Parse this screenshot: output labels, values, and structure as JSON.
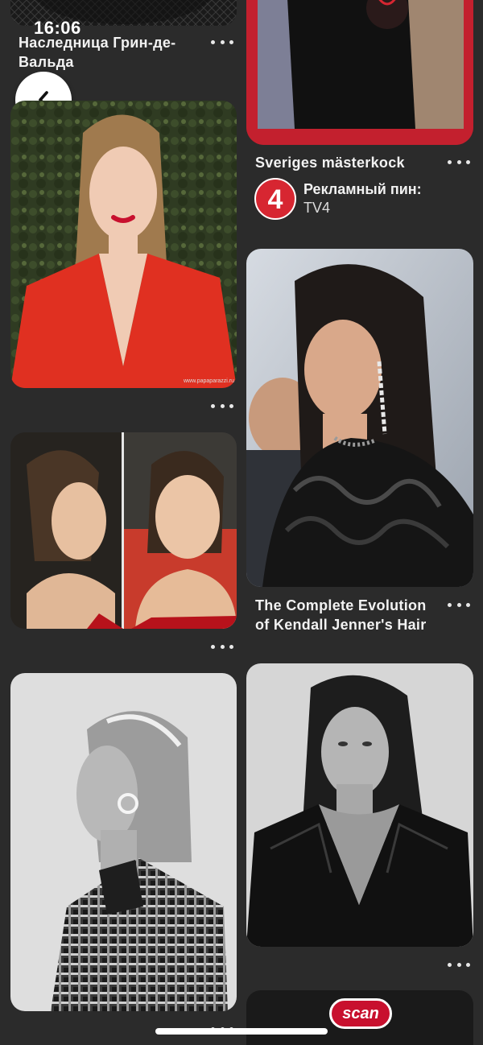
{
  "status_bar": {
    "time": "16:06"
  },
  "pins": {
    "top_left_title": "Наследница Грин-де-Вальда",
    "top_right_title": "Sveriges mästerkock",
    "ad": {
      "label": "Рекламный пин:",
      "advertiser": "TV4",
      "logo_text": "4"
    },
    "kendall_title": "The Complete Evolution of Kendall Jenner's Hair",
    "watermark": "www.papaparazzi.ru",
    "scan_logo": "scan"
  },
  "colors": {
    "background": "#2b2b2b",
    "tv4_red": "#d72631",
    "scan_red": "#c8102e",
    "text": "#f2f2f2"
  },
  "icons": {
    "back": "chevron-left-icon",
    "more": "more-options-icon",
    "signal": "cellular-signal-icon",
    "wifi": "wifi-icon",
    "battery": "battery-icon"
  }
}
